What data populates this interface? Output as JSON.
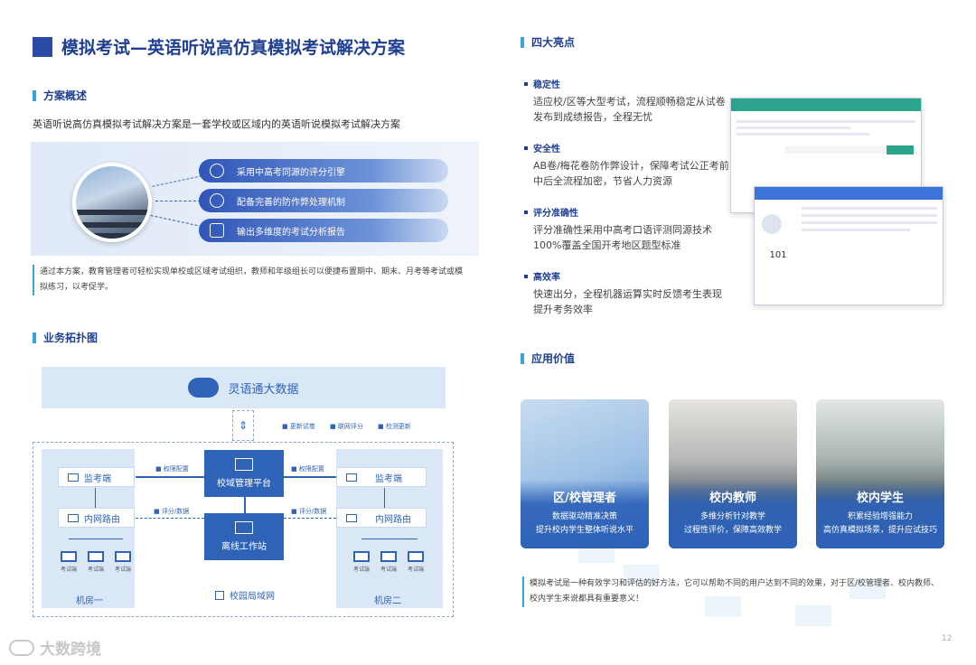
{
  "page": {
    "title": "模拟考试—英语听说高仿真模拟考试解决方案",
    "page_number": "12",
    "logo_text": "大数跨境"
  },
  "overview": {
    "heading": "方案概述",
    "intro": "英语听说高仿真模拟考试解决方案是一套学校或区域内的英语听说模拟考试解决方案",
    "features": [
      "采用中高考同源的评分引擎",
      "配备完善的防作弊处理机制",
      "输出多维度的考试分析报告"
    ],
    "note": "通过本方案，教育管理者可轻松实现单校或区域考试组织，教师和年级组长可以便捷布置期中、期末、月考等考试或模拟练习，以考促学。"
  },
  "topology": {
    "heading": "业务拓扑图",
    "cloud": "灵语通大数据",
    "sync_labels": [
      "更新试卷",
      "联网评分",
      "检测更新"
    ],
    "platform": "校域管理平台",
    "workstation": "离线工作站",
    "monitor": "监考端",
    "router": "内网路由",
    "exam_pc": "考试端",
    "link_auth": "权限配置",
    "link_score": "评分/数据",
    "room1": "机房一",
    "room2": "机房二",
    "lan": "校园局域网"
  },
  "highlights": {
    "heading": "四大亮点",
    "items": [
      {
        "title": "稳定性",
        "text": "适应校/区等大型考试，流程顺畅稳定从试卷发布到成绩报告，全程无忧"
      },
      {
        "title": "安全性",
        "text": "AB卷/梅花卷防作弊设计，保障考试公正考前中后全流程加密，节省人力资源"
      },
      {
        "title": "评分准确性",
        "text": "评分准确性采用中高考口语评测同源技术100%覆盖全国开考地区题型标准"
      },
      {
        "title": "高效率",
        "text": "快速出分，全程机器运算实时反馈考生表现提升考务效率"
      }
    ],
    "screen_score": "101"
  },
  "value": {
    "heading": "应用价值",
    "cards": [
      {
        "title": "区/校管理者",
        "line1": "数据驱动精准决策",
        "line2": "提升校内学生整体听说水平"
      },
      {
        "title": "校内教师",
        "line1": "多维分析针对教学",
        "line2": "过程性评价，保障高效教学"
      },
      {
        "title": "校内学生",
        "line1": "积累经验增强能力",
        "line2": "高仿真模拟场景，提升应试技巧"
      }
    ],
    "note": "模拟考试是一种有效学习和评估的好方法，它可以帮助不同的用户达到不同的效果，对于区/校管理者、校内教师、校内学生来说都具有重要意义！"
  },
  "colors": {
    "primary": "#2f63b8",
    "dark": "#1f3f91",
    "accent": "#3aa3d8"
  }
}
